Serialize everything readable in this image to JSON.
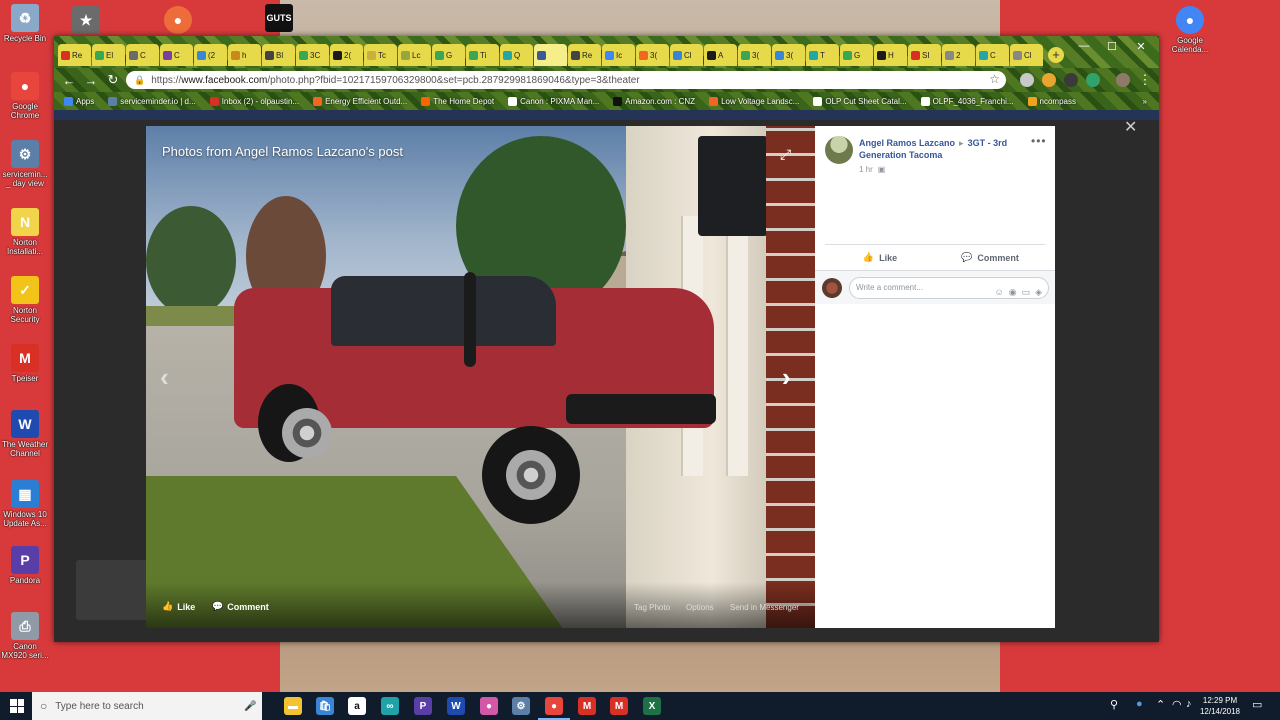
{
  "desktop": {
    "icons": [
      {
        "label": "Recycle Bin",
        "glyph": "♻",
        "color": "#8aa9c9"
      },
      {
        "label": "Google Chrome",
        "glyph": "●",
        "color": "#e8453c"
      },
      {
        "label": "servicemin... _ day view",
        "glyph": "⚙",
        "color": "#5b7fa6"
      },
      {
        "label": "Norton Installati...",
        "glyph": "N",
        "color": "#f2d44a"
      },
      {
        "label": "Norton Security",
        "glyph": "✓",
        "color": "#f2c318"
      },
      {
        "label": "Tpeiser",
        "glyph": "M",
        "color": "#d93025"
      },
      {
        "label": "The Weather Channel",
        "glyph": "W",
        "color": "#1f4bb0"
      },
      {
        "label": "Windows 10 Update As...",
        "glyph": "▦",
        "color": "#2a7fd4"
      },
      {
        "label": "Pandora",
        "glyph": "P",
        "color": "#5a3ea8"
      },
      {
        "label": "Canon MX920 seri...",
        "glyph": "⎙",
        "color": "#8f9aa6"
      }
    ],
    "right_icon": {
      "label": "Google Calenda...",
      "glyph": "●",
      "color": "#4285f4"
    },
    "top_icons": [
      {
        "label": "",
        "glyph": "★",
        "color": "#6b6b6b"
      },
      {
        "label": "",
        "glyph": "●",
        "color": "#ee6b3a"
      },
      {
        "label": "GUTS",
        "glyph": "",
        "color": "#111111"
      }
    ]
  },
  "browser": {
    "tabs": [
      {
        "label": "Re",
        "color": "#d93025"
      },
      {
        "label": "El",
        "color": "#3aa757"
      },
      {
        "label": "C",
        "color": "#6b6b6b"
      },
      {
        "label": "C",
        "color": "#7b3fa0"
      },
      {
        "label": "(2",
        "color": "#3a86d6"
      },
      {
        "label": "h",
        "color": "#c98a1b"
      },
      {
        "label": "Bl",
        "color": "#444444"
      },
      {
        "label": "3C",
        "color": "#3aa757"
      },
      {
        "label": "2(",
        "color": "#1b1b1b"
      },
      {
        "label": "Tc",
        "color": "#c7b13c"
      },
      {
        "label": "Lc",
        "color": "#9aa63c"
      },
      {
        "label": "G",
        "color": "#3aa757"
      },
      {
        "label": "Ti",
        "color": "#3aa757"
      },
      {
        "label": "Q",
        "color": "#23a6a6"
      },
      {
        "label": "",
        "color": "#3b5998"
      },
      {
        "label": "Re",
        "color": "#444444"
      },
      {
        "label": "Ic",
        "color": "#4285f4"
      },
      {
        "label": "3(",
        "color": "#f26522"
      },
      {
        "label": "Cl",
        "color": "#3a86d6"
      },
      {
        "label": "A",
        "color": "#1b1b1b"
      },
      {
        "label": "3(",
        "color": "#3aa757"
      },
      {
        "label": "3(",
        "color": "#3a86d6"
      },
      {
        "label": "T",
        "color": "#23a6a6"
      },
      {
        "label": "G",
        "color": "#3aa757"
      },
      {
        "label": "H",
        "color": "#1b1b1b"
      },
      {
        "label": "SI",
        "color": "#d93025"
      },
      {
        "label": "2",
        "color": "#888888"
      },
      {
        "label": "C",
        "color": "#23a6a6"
      },
      {
        "label": "Cl",
        "color": "#888888"
      }
    ],
    "active_tab_index": 14,
    "new_tab": "+",
    "window_controls": {
      "minimize": "—",
      "maximize": "☐",
      "close": "✕"
    },
    "url": {
      "scheme": "https://",
      "host": "www.facebook.com",
      "path": "/photo.php?fbid=10217159706329800&set=pcb.287929981869046&type=3&theater"
    },
    "bookmarks": [
      {
        "label": "Apps",
        "color": "#4285f4"
      },
      {
        "label": "serviceminder.io | d...",
        "color": "#5b7fa6"
      },
      {
        "label": "Inbox (2) - olpaustin...",
        "color": "#d93025"
      },
      {
        "label": "Energy Efficient Outd...",
        "color": "#f26522"
      },
      {
        "label": "The Home Depot",
        "color": "#f96302"
      },
      {
        "label": "Canon : PIXMA Man...",
        "color": "#ffffff"
      },
      {
        "label": "Amazon.com : CNZ",
        "color": "#111111"
      },
      {
        "label": "Low Voltage Landsc...",
        "color": "#f26522"
      },
      {
        "label": "OLP Cut Sheet Catal...",
        "color": "#ffffff"
      },
      {
        "label": "OLPF_4036_Franchi...",
        "color": "#ffffff"
      },
      {
        "label": "ncompass",
        "color": "#f2a020"
      }
    ],
    "bookmarks_more": "»"
  },
  "theater": {
    "close": "✕",
    "photo_title": "Photos from Angel Ramos Lazcano's post",
    "expand": "⤢",
    "prev": "‹",
    "next": "›",
    "footer": {
      "like": "Like",
      "comment": "Comment",
      "tag_photo": "Tag Photo",
      "options": "Options",
      "send": "Send in Messenger"
    }
  },
  "post": {
    "author": "Angel Ramos Lazcano",
    "group": "3GT - 3rd Generation Tacoma",
    "time": "1 hr",
    "more": "•••",
    "like": "Like",
    "comment": "Comment",
    "comment_placeholder": "Write a comment..."
  },
  "taskbar": {
    "search_placeholder": "Type here to search",
    "time": "12:29 PM",
    "date": "12/14/2018",
    "apps": [
      {
        "name": "file-explorer",
        "glyph": "▬",
        "color": "#f4c430"
      },
      {
        "name": "store",
        "glyph": "🛍",
        "color": "#3a86d6"
      },
      {
        "name": "amazon",
        "glyph": "a",
        "color": "#ffffff"
      },
      {
        "name": "arduino",
        "glyph": "∞",
        "color": "#1fa3a8"
      },
      {
        "name": "pandora",
        "glyph": "P",
        "color": "#5a3ea8"
      },
      {
        "name": "weather",
        "glyph": "W",
        "color": "#1f4bb0"
      },
      {
        "name": "maps",
        "glyph": "●",
        "color": "#d458a8"
      },
      {
        "name": "serviceminder",
        "glyph": "⚙",
        "color": "#5b7fa6"
      },
      {
        "name": "chrome",
        "glyph": "●",
        "color": "#e8453c"
      },
      {
        "name": "gmail",
        "glyph": "M",
        "color": "#d93025"
      },
      {
        "name": "gmail-2",
        "glyph": "M",
        "color": "#d93025"
      },
      {
        "name": "excel",
        "glyph": "X",
        "color": "#1e7145"
      }
    ]
  }
}
